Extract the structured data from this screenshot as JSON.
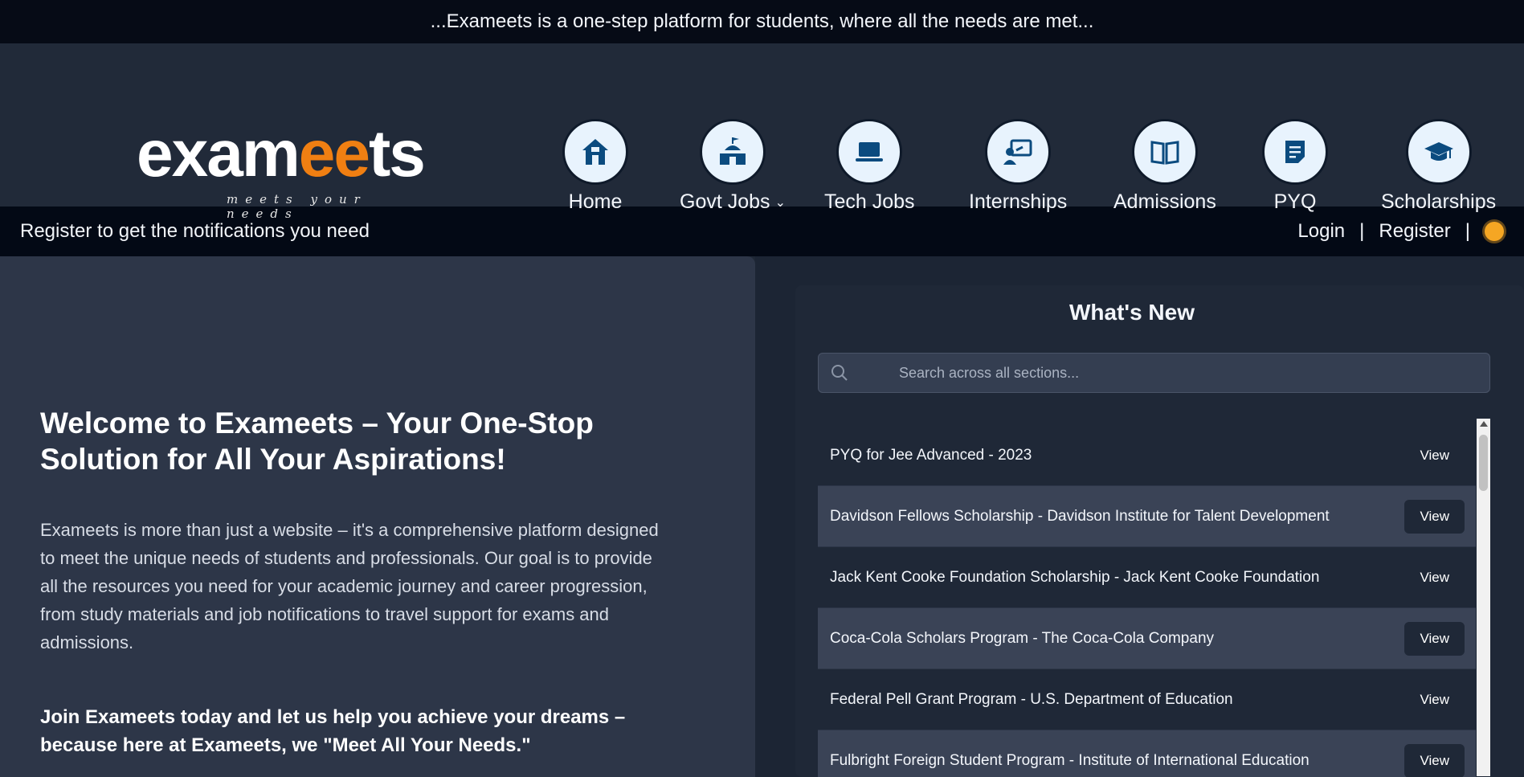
{
  "topbar": {
    "text": "...Exameets is a one-step platform for students, where all the needs are met..."
  },
  "logo": {
    "part1": "exam",
    "part2": "ee",
    "part3": "ts",
    "tagline": "meets your needs"
  },
  "nav": [
    {
      "label": "Home",
      "icon": "home-icon"
    },
    {
      "label": "Govt Jobs",
      "icon": "government-building-icon",
      "dropdown": true
    },
    {
      "label": "Tech Jobs",
      "icon": "laptop-icon"
    },
    {
      "label": "Internships",
      "icon": "presentation-icon"
    },
    {
      "label": "Admissions",
      "icon": "book-icon"
    },
    {
      "label": "PYQ",
      "icon": "document-icon"
    },
    {
      "label": "Scholarships",
      "icon": "graduation-cap-icon"
    }
  ],
  "subbar": {
    "message": "Register to get the notifications you need",
    "login": "Login",
    "register": "Register",
    "separator": "|"
  },
  "welcome": {
    "title": "Welcome to Exameets – Your One-Stop Solution for All Your Aspirations!",
    "paragraph": "Exameets is more than just a website – it's a comprehensive platform designed to meet the unique needs of students and professionals. Our goal is to provide all the resources you need for your academic journey and career progression, from study materials and job notifications to travel support for exams and admissions.",
    "cta": "Join Exameets today and let us help you achieve your dreams – because here at Exameets, we \"Meet All Your Needs.\""
  },
  "whats_new": {
    "title": "What's New",
    "search_placeholder": "Search across all sections...",
    "items": [
      {
        "text": "PYQ for Jee Advanced - 2023",
        "button": "View"
      },
      {
        "text": "Davidson Fellows Scholarship - Davidson Institute for Talent Development",
        "button": "View"
      },
      {
        "text": "Jack Kent Cooke Foundation Scholarship - Jack Kent Cooke Foundation",
        "button": "View"
      },
      {
        "text": "Coca-Cola Scholars Program - The Coca-Cola Company",
        "button": "View"
      },
      {
        "text": "Federal Pell Grant Program - U.S. Department of Education",
        "button": "View"
      },
      {
        "text": "Fulbright Foreign Student Program - Institute of International Education",
        "button": "View"
      }
    ]
  },
  "colors": {
    "accent": "#f07f12",
    "dark": "#060b16",
    "icon_blue": "#0b4b7f"
  }
}
